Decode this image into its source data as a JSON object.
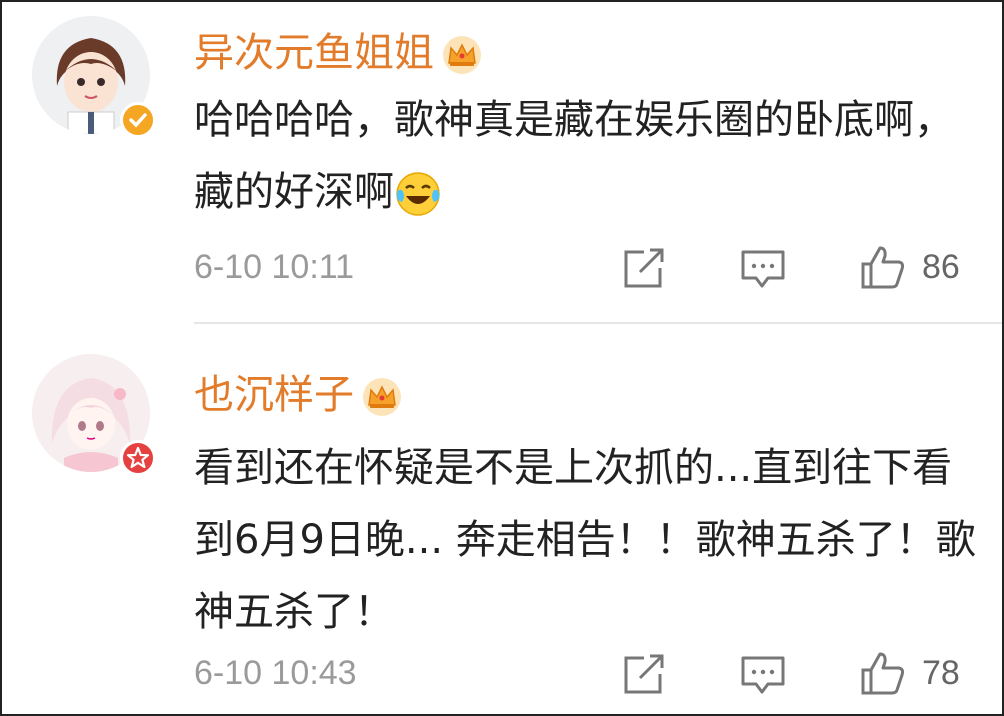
{
  "comments": [
    {
      "username": "异次元鱼姐姐",
      "badge": "verified-gold",
      "text": "哈哈哈哈，歌神真是藏在娱乐圈的卧底啊，藏的好深啊",
      "emoji": "laugh-cry-emoji",
      "time": "6-10 10:11",
      "likes": "86"
    },
    {
      "username": "也沉样子",
      "badge": "star-red",
      "text": "看到还在怀疑是不是上次抓的...直到往下看到6月9日晚... 奔走相告！！歌神五杀了！歌神五杀了！",
      "time": "6-10 10:43",
      "likes": "78"
    }
  ],
  "colors": {
    "username": "#e27c2a",
    "meta": "#9a9a9a",
    "gold_badge": "#f5a623",
    "red_badge": "#e64141"
  }
}
